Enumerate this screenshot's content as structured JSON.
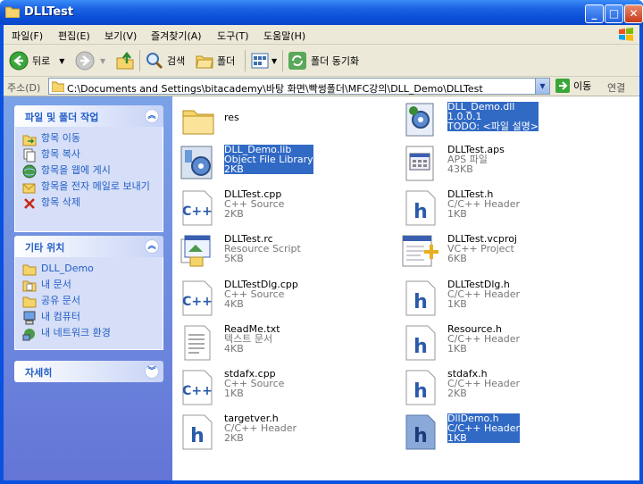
{
  "window": {
    "title": "DLLTest"
  },
  "menu": [
    "파일(F)",
    "편집(E)",
    "보기(V)",
    "즐겨찾기(A)",
    "도구(T)",
    "도움말(H)"
  ],
  "toolbar": {
    "back": "뒤로",
    "search": "검색",
    "folders": "폴더",
    "sync": "폴더 동기화"
  },
  "address": {
    "label": "주소(D)",
    "path": "C:\\Documents and Settings\\bitacademy\\바탕 화면\\빡썽폴더\\MFC강의\\DLL_Demo\\DLLTest",
    "go": "이동",
    "links": "연결"
  },
  "sidebar": {
    "tasks": {
      "title": "파일 및 폴더 작업",
      "items": [
        "항목 이동",
        "항목 복사",
        "항목을 웹에 게시",
        "항목을 전자 메일로 보내기",
        "항목 삭제"
      ]
    },
    "places": {
      "title": "기타 위치",
      "items": [
        "DLL_Demo",
        "내 문서",
        "공유 문서",
        "내 컴퓨터",
        "내 네트워크 환경"
      ]
    },
    "details": {
      "title": "자세히"
    }
  },
  "files": [
    {
      "name": "res",
      "l2": "",
      "l3": "",
      "icon": "folder-icon"
    },
    {
      "name": "DLL_Demo.dll",
      "l2": "1.0.0.1",
      "l3": "TODO: <파일 설명>",
      "icon": "dll-icon",
      "selected": true
    },
    {
      "name": "DLL_Demo.lib",
      "l2": "Object File Library",
      "l3": "2KB",
      "icon": "lib-icon",
      "selected": true
    },
    {
      "name": "DLLTest.aps",
      "l2": "APS 파일",
      "l3": "43KB",
      "icon": "aps-icon"
    },
    {
      "name": "DLLTest.cpp",
      "l2": "C++ Source",
      "l3": "2KB",
      "icon": "cpp-icon"
    },
    {
      "name": "DLLTest.h",
      "l2": "C/C++ Header",
      "l3": "1KB",
      "icon": "header-icon"
    },
    {
      "name": "DLLTest.rc",
      "l2": "Resource Script",
      "l3": "5KB",
      "icon": "rc-icon"
    },
    {
      "name": "DLLTest.vcproj",
      "l2": "VC++ Project",
      "l3": "6KB",
      "icon": "vcproj-icon"
    },
    {
      "name": "DLLTestDlg.cpp",
      "l2": "C++ Source",
      "l3": "4KB",
      "icon": "cpp-icon"
    },
    {
      "name": "DLLTestDlg.h",
      "l2": "C/C++ Header",
      "l3": "1KB",
      "icon": "header-icon"
    },
    {
      "name": "ReadMe.txt",
      "l2": "텍스트 문서",
      "l3": "4KB",
      "icon": "text-icon"
    },
    {
      "name": "Resource.h",
      "l2": "C/C++ Header",
      "l3": "1KB",
      "icon": "header-icon"
    },
    {
      "name": "stdafx.cpp",
      "l2": "C++ Source",
      "l3": "1KB",
      "icon": "cpp-icon"
    },
    {
      "name": "stdafx.h",
      "l2": "C/C++ Header",
      "l3": "2KB",
      "icon": "header-icon"
    },
    {
      "name": "targetver.h",
      "l2": "C/C++ Header",
      "l3": "2KB",
      "icon": "header-icon"
    },
    {
      "name": "DllDemo.h",
      "l2": "C/C++ Header",
      "l3": "1KB",
      "icon": "header-icon",
      "selected": true
    }
  ]
}
